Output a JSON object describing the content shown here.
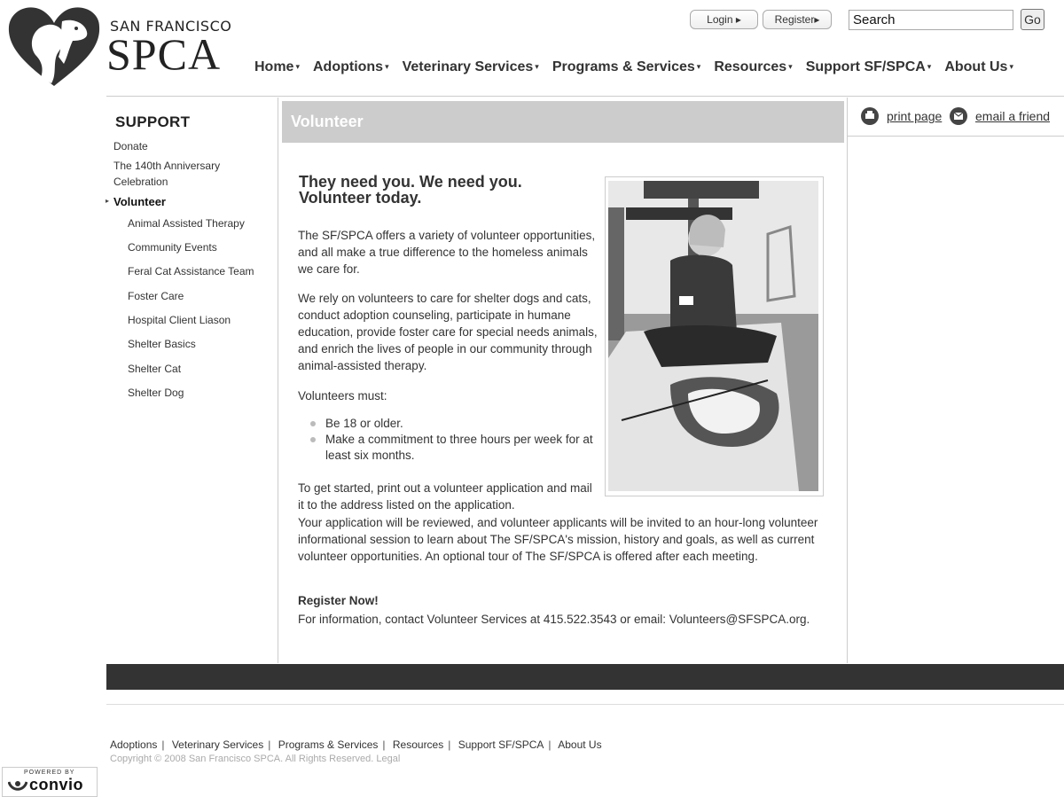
{
  "header": {
    "logo_line1": "SAN FRANCISCO",
    "logo_line2": "SPCA",
    "login_label": "Login ▸",
    "register_label": "Register▸",
    "search_placeholder": "Search",
    "go_label": "Go"
  },
  "nav": {
    "items": [
      {
        "label": "Home"
      },
      {
        "label": "Adoptions"
      },
      {
        "label": "Veterinary Services"
      },
      {
        "label": "Programs & Services"
      },
      {
        "label": "Resources"
      },
      {
        "label": "Support SF/SPCA"
      },
      {
        "label": "About Us"
      }
    ],
    "arrow": "▾"
  },
  "sidebar": {
    "title": "SUPPORT",
    "donate": "Donate",
    "anniversary_line1": "The 140th Anniversary",
    "anniversary_line2": "Celebration",
    "active": "Volunteer",
    "active_marker": "▸",
    "sub_items": [
      {
        "label": "Animal Assisted Therapy"
      },
      {
        "label": "Community Events"
      },
      {
        "label": "Feral Cat Assistance Team"
      },
      {
        "label": "Foster Care"
      },
      {
        "label": "Hospital Client Liason"
      },
      {
        "label": "Shelter Basics"
      },
      {
        "label": "Shelter Cat"
      },
      {
        "label": "Shelter Dog"
      }
    ]
  },
  "content": {
    "page_title": "Volunteer",
    "headline": "They need you. We need you. Volunteer today.",
    "p1": "The SF/SPCA offers a variety of volunteer opportunities, and all make a true difference to the homeless animals we care for.",
    "p2": "We rely on volunteers to care for shelter dogs and cats, conduct adoption counseling, participate in humane education,  provide foster care for special needs animals, and enrich the lives of people in our community through animal-assisted therapy.",
    "p3": "Volunteers must:",
    "requirements": [
      {
        "text": "Be 18 or older."
      },
      {
        "text": "Make a commitment to three hours per week for at least six months."
      }
    ],
    "p4": "To get started, print out a volunteer application and mail it to the address listed on the application.",
    "p5": "Your application will be reviewed, and volunteer applicants will be invited to an hour-long volunteer informational session to learn about The SF/SPCA's mission, history and goals, as well as current volunteer opportunities. An optional tour of The SF/SPCA is offered after each meeting.",
    "register_heading": "Register Now!",
    "p6": "For information, contact Volunteer Services at 415.522.3543 or email: Volunteers@SFSPCA.org."
  },
  "utility": {
    "print_label": "print page",
    "email_label": "email a friend"
  },
  "footer": {
    "links": [
      {
        "label": "Adoptions"
      },
      {
        "label": "Veterinary Services"
      },
      {
        "label": "Programs & Services"
      },
      {
        "label": "Resources"
      },
      {
        "label": "Support SF/SPCA"
      },
      {
        "label": "About Us"
      }
    ],
    "separator": "|",
    "copyright": "Copyright © 2008 San Francisco SPCA. All Rights Reserved.  Legal",
    "powered_by": "POWERED BY",
    "convio": "convio"
  },
  "icons": {
    "print": "printer-icon",
    "email": "envelope-icon",
    "logo": "heart-dog-cat-logo"
  }
}
